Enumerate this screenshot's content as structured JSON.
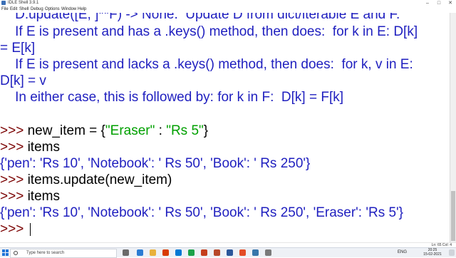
{
  "window": {
    "title": "IDLE Shell 3.9.1",
    "minimize": "–",
    "maximize": "□",
    "close": "✕"
  },
  "menu": [
    "File",
    "Edit",
    "Shell",
    "Debug",
    "Options",
    "Window",
    "Help"
  ],
  "doc_lines": [
    "    D.update([E, ]**F) -> None.  Update D from dict/iterable E and F.",
    "    If E is present and has a .keys() method, then does:  for k in E: D[k]",
    "= E[k]",
    "    If E is present and lacks a .keys() method, then does:  for k, v in E:",
    "D[k] = v",
    "    In either case, this is followed by: for k in F:  D[k] = F[k]"
  ],
  "shell": {
    "prompt": ">>>",
    "cmd1_prefix": "new_item = {",
    "cmd1_key": "\"Eraser\"",
    "cmd1_sep": " : ",
    "cmd1_val": "\"Rs 5\"",
    "cmd1_suffix": "}",
    "cmd2": "items",
    "out1": "{'pen': 'Rs 10', 'Notebook': ' Rs 50', 'Book': ' Rs 250'}",
    "cmd3": "items.update(new_item)",
    "cmd4": "items",
    "out2": "{'pen': 'Rs 10', 'Notebook': ' Rs 50', 'Book': ' Rs 250', 'Eraser': 'Rs 5'}"
  },
  "status": {
    "position": "Ln: 65  Col: 4"
  },
  "taskbar": {
    "search_placeholder": "Type here to search",
    "lang": "ENG",
    "time": "20:25",
    "date": "15-02-2021"
  }
}
